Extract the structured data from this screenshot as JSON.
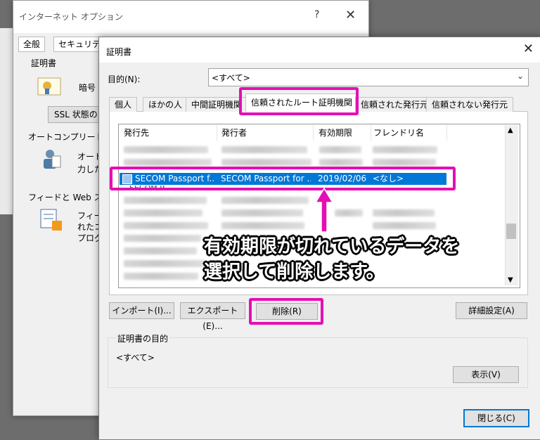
{
  "background_window": {
    "title": "インターネット オプション",
    "help_glyph": "?",
    "close_glyph": "✕",
    "tabs": [
      "全般",
      "セキュリティ"
    ],
    "section_certificates": "証明書",
    "cert_text": "暗号",
    "ssl_button": "SSL 状態の",
    "section_autocomplete": "オートコンプリート",
    "autocomplete_text_1": "オート",
    "autocomplete_text_2": "力した",
    "section_feeds": "フィードと Web スライ",
    "feeds_text_1": "フィー",
    "feeds_text_2": "れたコ",
    "feeds_text_3": "プログ"
  },
  "dialog": {
    "title": "証明書",
    "close_glyph": "✕",
    "purpose_label": "目的(N):",
    "purpose_value": "<すべて>",
    "tabs": [
      "個人",
      "ほかの人",
      "中間証明機関",
      "信頼されたルート証明機関",
      "信頼された発行元",
      "信頼されない発行元"
    ],
    "active_tab_index": 3,
    "columns": [
      "発行先",
      "発行者",
      "有効期限",
      "フレンドリ名"
    ],
    "selected_row": {
      "issued_to": "SECOM Passport f...",
      "issued_by": "SECOM Passport for ...",
      "expiration": "2019/02/06",
      "friendly_name": "<なし>"
    },
    "partial_row_text": "SECOM P",
    "buttons": {
      "import": "インポート(I)...",
      "export": "エクスポート(E)...",
      "remove": "削除(R)",
      "advanced": "詳細設定(A)",
      "view": "表示(V)",
      "close": "閉じる(C)"
    },
    "purpose_group_label": "証明書の目的",
    "purpose_group_value": "<すべて>"
  },
  "annotation": {
    "line1": "有効期限が切れているデータを",
    "line2": "選択して削除します。",
    "color": "#e40fb4"
  }
}
